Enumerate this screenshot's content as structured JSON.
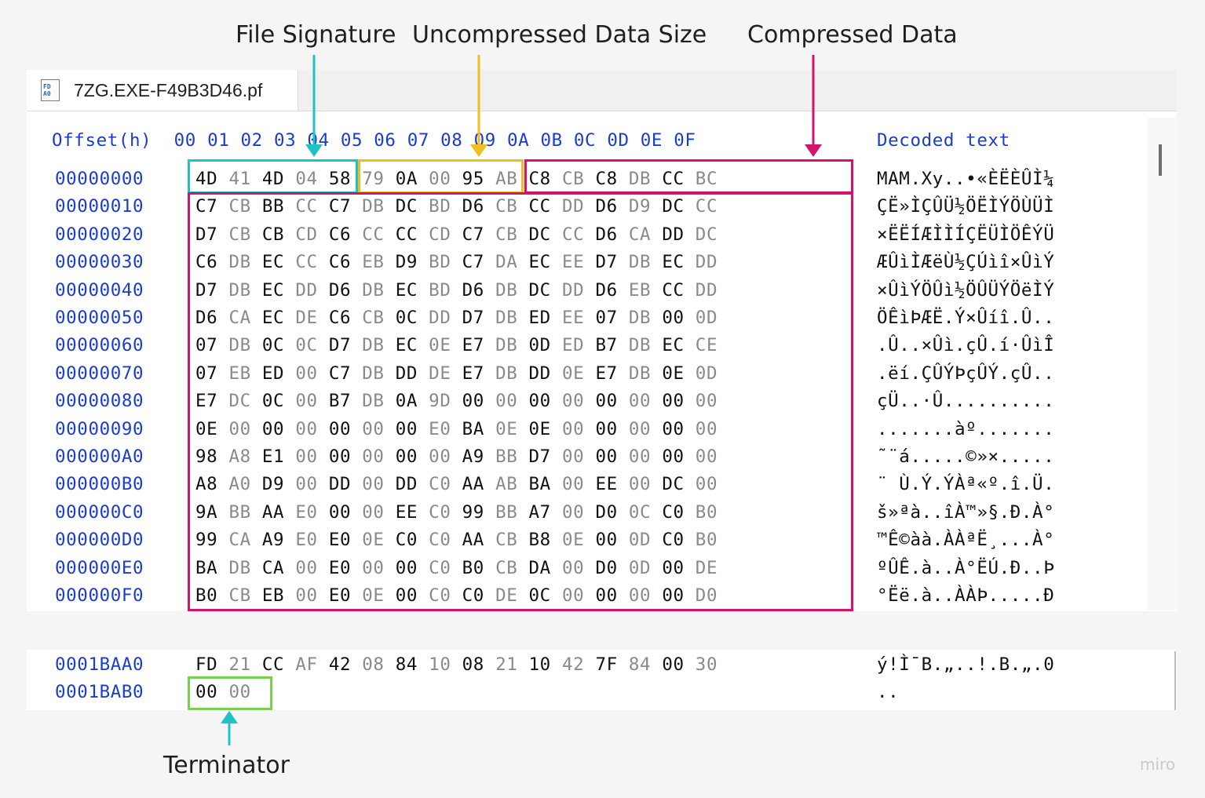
{
  "callouts": {
    "file_signature": "File Signature",
    "uncompressed_size": "Uncompressed Data Size",
    "compressed_data": "Compressed Data",
    "terminator": "Terminator"
  },
  "tab": {
    "title": "7ZG.EXE-F49B3D46.pf",
    "icon": "prefetch-file-icon"
  },
  "hex_header": {
    "offset_label": "Offset(h)",
    "columns": "00 01 02 03 04 05 06 07 08 09 0A 0B 0C 0D 0E 0F",
    "decoded_label": "Decoded text"
  },
  "rows_top": [
    {
      "offset": "00000000",
      "bytes": [
        "4D",
        "41",
        "4D",
        "04",
        "58",
        "79",
        "0A",
        "00",
        "95",
        "AB",
        "C8",
        "CB",
        "C8",
        "DB",
        "CC",
        "BC"
      ],
      "text": "MAM.Xy..•«ÈËÈÛÌ¼"
    },
    {
      "offset": "00000010",
      "bytes": [
        "C7",
        "CB",
        "BB",
        "CC",
        "C7",
        "DB",
        "DC",
        "BD",
        "D6",
        "CB",
        "CC",
        "DD",
        "D6",
        "D9",
        "DC",
        "CC"
      ],
      "text": "ÇË»ÌÇÛÜ½ÖËÌÝÖÙÜÌ"
    },
    {
      "offset": "00000020",
      "bytes": [
        "D7",
        "CB",
        "CB",
        "CD",
        "C6",
        "CC",
        "CC",
        "CD",
        "C7",
        "CB",
        "DC",
        "CC",
        "D6",
        "CA",
        "DD",
        "DC"
      ],
      "text": "×ËËÍÆÌÌÍÇËÜÌÖÊÝÜ"
    },
    {
      "offset": "00000030",
      "bytes": [
        "C6",
        "DB",
        "EC",
        "CC",
        "C6",
        "EB",
        "D9",
        "BD",
        "C7",
        "DA",
        "EC",
        "EE",
        "D7",
        "DB",
        "EC",
        "DD"
      ],
      "text": "ÆÛìÌÆëÙ½ÇÚìî×ÛìÝ"
    },
    {
      "offset": "00000040",
      "bytes": [
        "D7",
        "DB",
        "EC",
        "DD",
        "D6",
        "DB",
        "EC",
        "BD",
        "D6",
        "DB",
        "DC",
        "DD",
        "D6",
        "EB",
        "CC",
        "DD"
      ],
      "text": "×ÛìÝÖÛì½ÖÛÜÝÖëÌÝ"
    },
    {
      "offset": "00000050",
      "bytes": [
        "D6",
        "CA",
        "EC",
        "DE",
        "C6",
        "CB",
        "0C",
        "DD",
        "D7",
        "DB",
        "ED",
        "EE",
        "07",
        "DB",
        "00",
        "0D"
      ],
      "text": "ÖÊìÞÆË.Ý×Ûíî.Û.."
    },
    {
      "offset": "00000060",
      "bytes": [
        "07",
        "DB",
        "0C",
        "0C",
        "D7",
        "DB",
        "EC",
        "0E",
        "E7",
        "DB",
        "0D",
        "ED",
        "B7",
        "DB",
        "EC",
        "CE"
      ],
      "text": ".Û..×Ûì.çÛ.í·ÛìÎ"
    },
    {
      "offset": "00000070",
      "bytes": [
        "07",
        "EB",
        "ED",
        "00",
        "C7",
        "DB",
        "DD",
        "DE",
        "E7",
        "DB",
        "DD",
        "0E",
        "E7",
        "DB",
        "0E",
        "0D"
      ],
      "text": ".ëí.ÇÛÝÞçÛÝ.çÛ.."
    },
    {
      "offset": "00000080",
      "bytes": [
        "E7",
        "DC",
        "0C",
        "00",
        "B7",
        "DB",
        "0A",
        "9D",
        "00",
        "00",
        "00",
        "00",
        "00",
        "00",
        "00",
        "00"
      ],
      "text": "çÜ..·Û.........."
    },
    {
      "offset": "00000090",
      "bytes": [
        "0E",
        "00",
        "00",
        "00",
        "00",
        "00",
        "00",
        "E0",
        "BA",
        "0E",
        "0E",
        "00",
        "00",
        "00",
        "00",
        "00"
      ],
      "text": ".......àº......."
    },
    {
      "offset": "000000A0",
      "bytes": [
        "98",
        "A8",
        "E1",
        "00",
        "00",
        "00",
        "00",
        "00",
        "A9",
        "BB",
        "D7",
        "00",
        "00",
        "00",
        "00",
        "00"
      ],
      "text": "˜¨á.....©»×....."
    },
    {
      "offset": "000000B0",
      "bytes": [
        "A8",
        "A0",
        "D9",
        "00",
        "DD",
        "00",
        "DD",
        "C0",
        "AA",
        "AB",
        "BA",
        "00",
        "EE",
        "00",
        "DC",
        "00"
      ],
      "text": "¨ Ù.Ý.ÝÀª«º.î.Ü."
    },
    {
      "offset": "000000C0",
      "bytes": [
        "9A",
        "BB",
        "AA",
        "E0",
        "00",
        "00",
        "EE",
        "C0",
        "99",
        "BB",
        "A7",
        "00",
        "D0",
        "0C",
        "C0",
        "B0"
      ],
      "text": "š»ªà..îÀ™»§.Ð.À°"
    },
    {
      "offset": "000000D0",
      "bytes": [
        "99",
        "CA",
        "A9",
        "E0",
        "E0",
        "0E",
        "C0",
        "C0",
        "AA",
        "CB",
        "B8",
        "0E",
        "00",
        "0D",
        "C0",
        "B0"
      ],
      "text": "™Ê©àà.ÀÀªË¸...À°"
    },
    {
      "offset": "000000E0",
      "bytes": [
        "BA",
        "DB",
        "CA",
        "00",
        "E0",
        "00",
        "00",
        "C0",
        "B0",
        "CB",
        "DA",
        "00",
        "D0",
        "0D",
        "00",
        "DE"
      ],
      "text": "ºÛÊ.à..À°ËÚ.Ð..Þ"
    },
    {
      "offset": "000000F0",
      "bytes": [
        "B0",
        "CB",
        "EB",
        "00",
        "E0",
        "0E",
        "00",
        "C0",
        "C0",
        "DE",
        "0C",
        "00",
        "00",
        "00",
        "00",
        "D0"
      ],
      "text": "°Ëë.à..ÀÀÞ.....Ð"
    }
  ],
  "rows_bottom": [
    {
      "offset": "0001BAA0",
      "bytes": [
        "FD",
        "21",
        "CC",
        "AF",
        "42",
        "08",
        "84",
        "10",
        "08",
        "21",
        "10",
        "42",
        "7F",
        "84",
        "00",
        "30"
      ],
      "text": "ý!Ì¯B.„..!.B.„.0"
    },
    {
      "offset": "0001BAB0",
      "bytes": [
        "00",
        "00"
      ],
      "text": ".."
    }
  ],
  "watermark": "miro",
  "colors": {
    "signature_box": "#1fc3c6",
    "size_box": "#f2bd1e",
    "compressed_box": "#d4146a",
    "terminator_box": "#79cf4f",
    "offset_text": "#1a3cd1"
  }
}
